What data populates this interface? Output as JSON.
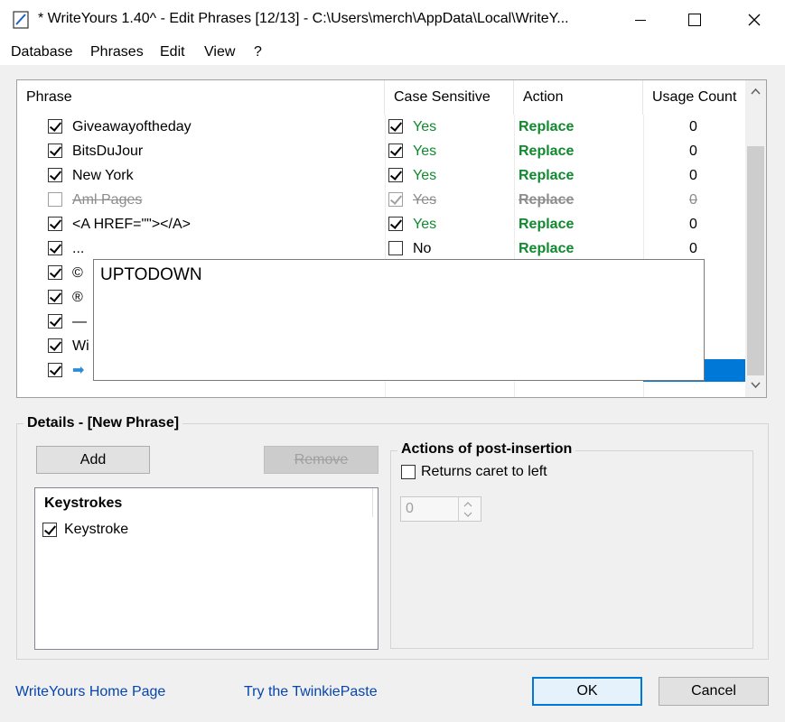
{
  "window": {
    "title": "* WriteYours 1.40^ - Edit Phrases [12/13] - C:\\Users\\merch\\AppData\\Local\\WriteY...",
    "minimize": "—",
    "maximize": "☐",
    "close": "✕"
  },
  "menu": [
    "Database",
    "Phrases",
    "Edit",
    "View",
    "?"
  ],
  "table": {
    "headers": [
      "Phrase",
      "Case Sensitive",
      "Action",
      "Usage Count"
    ],
    "rows": [
      {
        "checked": true,
        "phrase": "Giveawayoftheday",
        "case_checked": true,
        "case": "Yes",
        "action": "Replace",
        "usage": "0",
        "disabled": false
      },
      {
        "checked": true,
        "phrase": "BitsDuJour",
        "case_checked": true,
        "case": "Yes",
        "action": "Replace",
        "usage": "0",
        "disabled": false
      },
      {
        "checked": true,
        "phrase": "New York",
        "case_checked": true,
        "case": "Yes",
        "action": "Replace",
        "usage": "0",
        "disabled": false
      },
      {
        "checked": false,
        "phrase": "Aml Pages",
        "case_checked": true,
        "case": "Yes",
        "action": "Replace",
        "usage": "0",
        "disabled": true
      },
      {
        "checked": true,
        "phrase": "<A HREF=\"\"></A>",
        "case_checked": true,
        "case": "Yes",
        "action": "Replace",
        "usage": "0",
        "disabled": false
      },
      {
        "checked": true,
        "phrase": "...",
        "case_checked": false,
        "case": "No",
        "action": "Replace",
        "usage": "0",
        "disabled": false
      },
      {
        "checked": true,
        "phrase": "©"
      },
      {
        "checked": true,
        "phrase": "®"
      },
      {
        "checked": true,
        "phrase": "—"
      },
      {
        "checked": true,
        "phrase": "Wi"
      },
      {
        "checked": true,
        "phrase": "➡"
      }
    ]
  },
  "popup": {
    "text": "UPTODOWN"
  },
  "details": {
    "title": "Details - [New Phrase]",
    "add_label": "Add",
    "remove_label": "Remove",
    "keystrokes_header": "Keystrokes",
    "keystroke_label": "Keystroke",
    "post_title": "Actions of post-insertion",
    "returns_caret_label": "Returns caret to left",
    "spinner_value": "0"
  },
  "footer": {
    "home_link": "WriteYours Home Page",
    "twinkie_link": "Try the TwinkiePaste",
    "ok_label": "OK",
    "cancel_label": "Cancel"
  },
  "colors": {
    "accent": "#0078d7",
    "green": "#108a2e",
    "link": "#0645ad"
  }
}
